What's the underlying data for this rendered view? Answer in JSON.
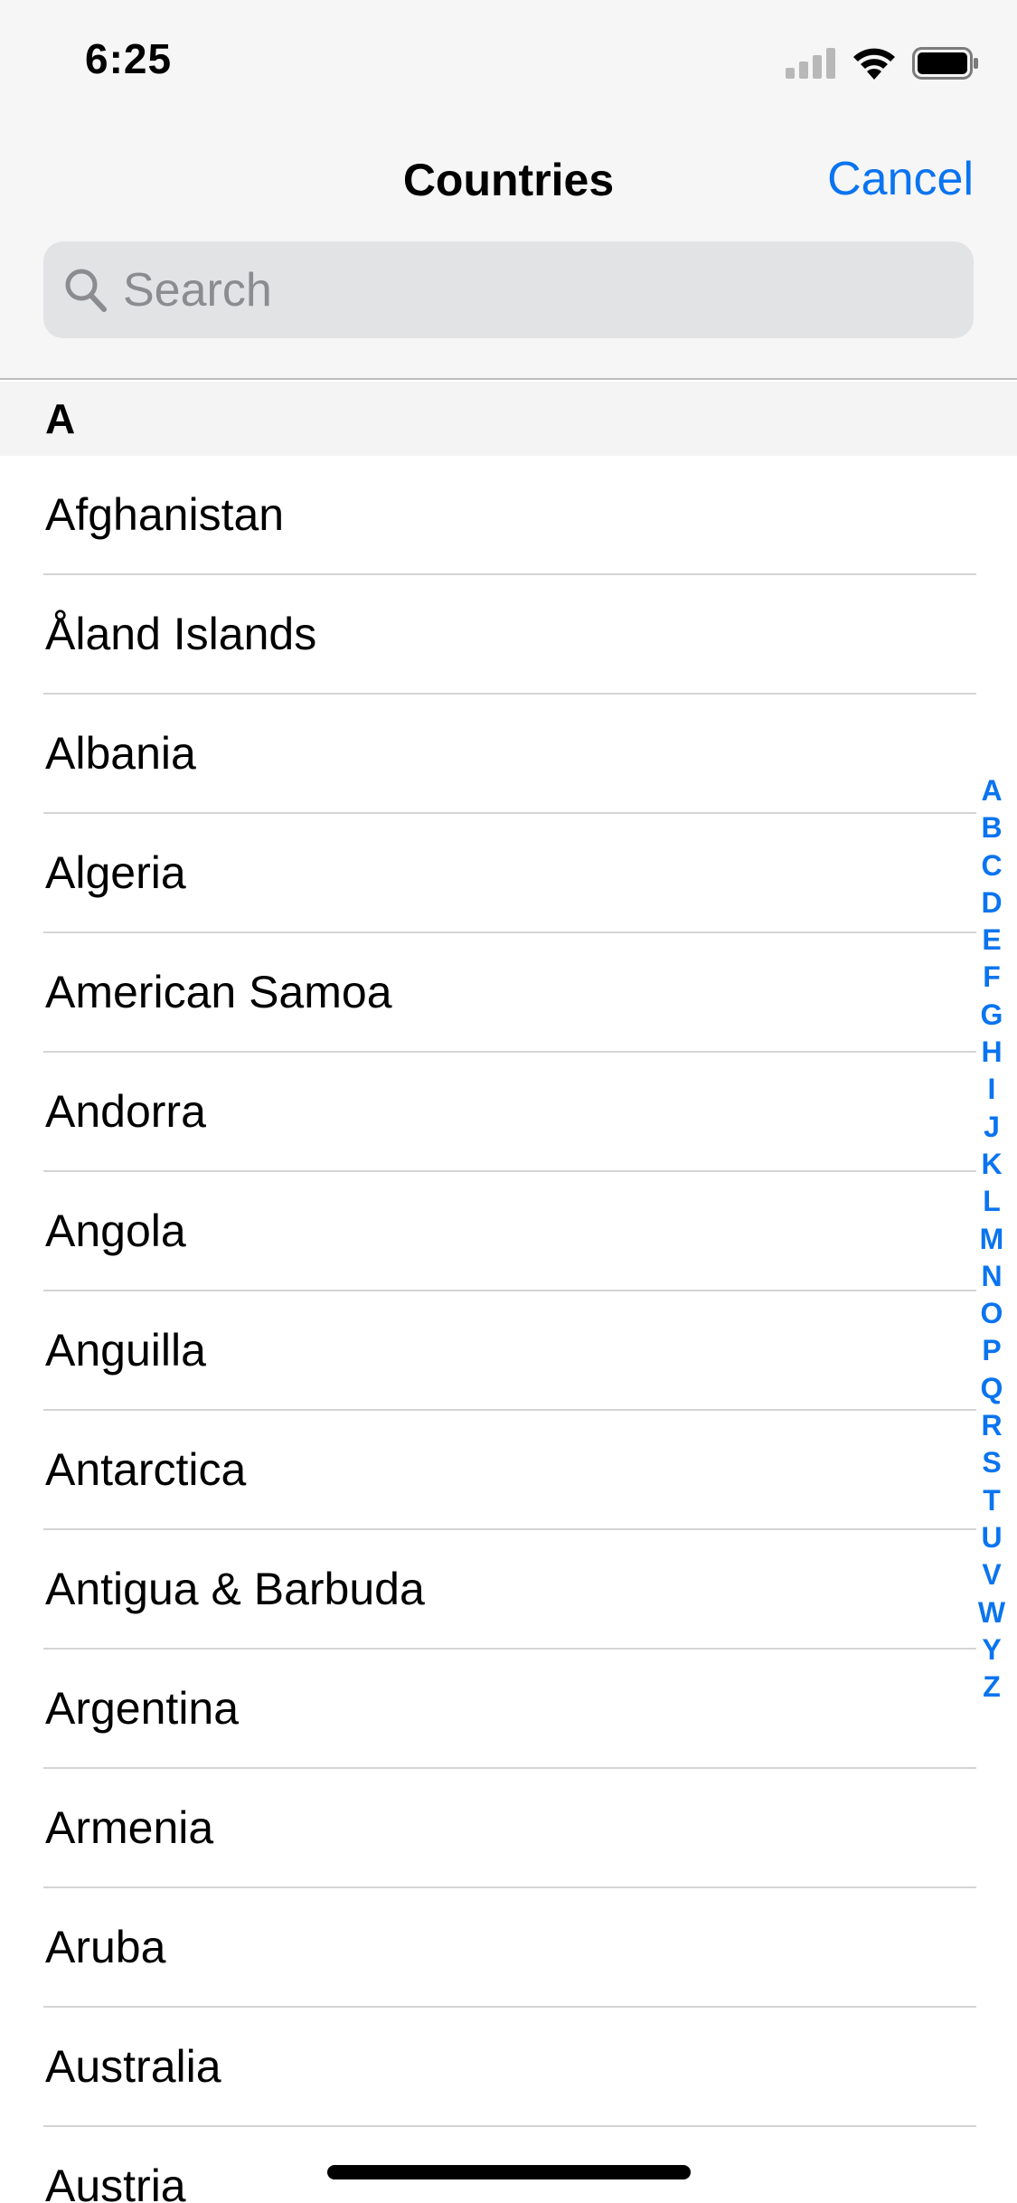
{
  "status_bar": {
    "time": "6:25"
  },
  "nav": {
    "title": "Countries",
    "cancel_label": "Cancel"
  },
  "search": {
    "placeholder": "Search"
  },
  "section": {
    "letter": "A"
  },
  "countries": [
    "Afghanistan",
    "Åland Islands",
    "Albania",
    "Algeria",
    "American Samoa",
    "Andorra",
    "Angola",
    "Anguilla",
    "Antarctica",
    "Antigua & Barbuda",
    "Argentina",
    "Armenia",
    "Aruba",
    "Australia",
    "Austria"
  ],
  "index_letters": [
    "A",
    "B",
    "C",
    "D",
    "E",
    "F",
    "G",
    "H",
    "I",
    "J",
    "K",
    "L",
    "M",
    "N",
    "O",
    "P",
    "Q",
    "R",
    "S",
    "T",
    "U",
    "V",
    "W",
    "Y",
    "Z"
  ],
  "colors": {
    "accent": "#0a74f0",
    "header_bg": "#f6f6f6",
    "search_bg": "#e2e3e5"
  }
}
